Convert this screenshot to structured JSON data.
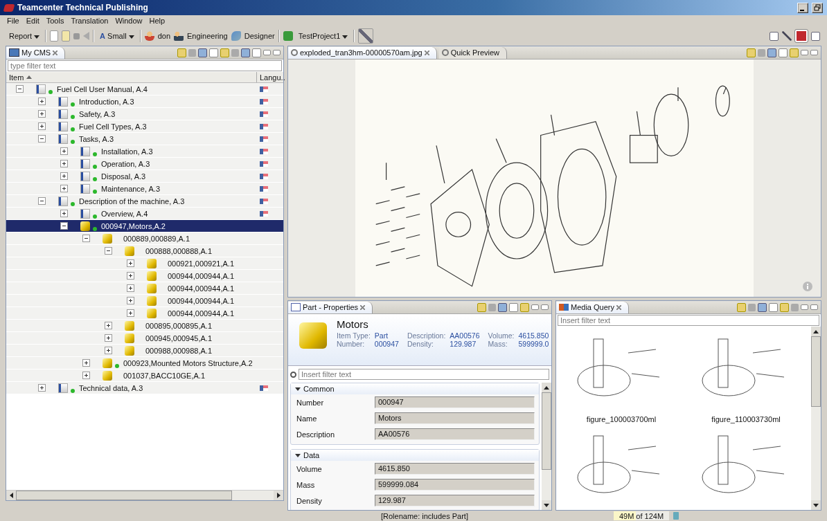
{
  "window": {
    "title": "Teamcenter Technical Publishing"
  },
  "menu": [
    "File",
    "Edit",
    "Tools",
    "Translation",
    "Window",
    "Help"
  ],
  "toolbar": {
    "report": "Report",
    "font_icon": "A",
    "font_size": "Small",
    "user": "don",
    "group": "Engineering",
    "role": "Designer",
    "project": "TestProject1"
  },
  "cms_panel": {
    "title": "My CMS",
    "filter_placeholder": "type filter text",
    "columns": [
      "Item",
      "Langu.."
    ],
    "items": [
      {
        "label": "Fuel Cell User Manual, A.4",
        "kind": "document",
        "status_dot": true,
        "expanded": true,
        "selected": false,
        "children": [
          {
            "label": "Introduction, A.3",
            "kind": "document",
            "status_dot": true,
            "expanded": false,
            "selected": false
          },
          {
            "label": "Safety, A.3",
            "kind": "document",
            "status_dot": true,
            "expanded": false,
            "selected": false
          },
          {
            "label": "Fuel Cell Types, A.3",
            "kind": "document",
            "status_dot": true,
            "expanded": false,
            "selected": false
          },
          {
            "label": "Tasks, A.3",
            "kind": "document",
            "status_dot": true,
            "expanded": true,
            "selected": false,
            "children": [
              {
                "label": "Installation, A.3",
                "kind": "document",
                "status_dot": true,
                "expanded": false,
                "selected": false
              },
              {
                "label": "Operation, A.3",
                "kind": "document",
                "status_dot": true,
                "expanded": false,
                "selected": false
              },
              {
                "label": "Disposal, A.3",
                "kind": "document",
                "status_dot": true,
                "expanded": false,
                "selected": false
              },
              {
                "label": "Maintenance, A.3",
                "kind": "document",
                "status_dot": true,
                "expanded": false,
                "selected": false
              }
            ]
          },
          {
            "label": "Description of the machine, A.3",
            "kind": "document",
            "status_dot": true,
            "expanded": true,
            "selected": false,
            "children": [
              {
                "label": "Overview, A.4",
                "kind": "document",
                "status_dot": true,
                "expanded": false,
                "selected": false
              },
              {
                "label": "000947,Motors,A.2",
                "kind": "part",
                "status_dot": true,
                "expanded": true,
                "selected": true,
                "children": [
                  {
                    "label": "000889,000889,A.1",
                    "kind": "part",
                    "status_dot": false,
                    "expanded": true,
                    "selected": false,
                    "children": [
                      {
                        "label": "000888,000888,A.1",
                        "kind": "part",
                        "status_dot": false,
                        "expanded": true,
                        "selected": false,
                        "children": [
                          {
                            "label": "000921,000921,A.1",
                            "kind": "part",
                            "status_dot": false,
                            "expanded": false,
                            "selected": false
                          },
                          {
                            "label": "000944,000944,A.1",
                            "kind": "part",
                            "status_dot": false,
                            "expanded": false,
                            "selected": false
                          },
                          {
                            "label": "000944,000944,A.1",
                            "kind": "part",
                            "status_dot": false,
                            "expanded": false,
                            "selected": false
                          },
                          {
                            "label": "000944,000944,A.1",
                            "kind": "part",
                            "status_dot": false,
                            "expanded": false,
                            "selected": false
                          },
                          {
                            "label": "000944,000944,A.1",
                            "kind": "part",
                            "status_dot": false,
                            "expanded": false,
                            "selected": false
                          }
                        ]
                      },
                      {
                        "label": "000895,000895,A.1",
                        "kind": "part",
                        "status_dot": false,
                        "expanded": false,
                        "selected": false
                      },
                      {
                        "label": "000945,000945,A.1",
                        "kind": "part",
                        "status_dot": false,
                        "expanded": false,
                        "selected": false
                      },
                      {
                        "label": "000988,000988,A.1",
                        "kind": "part",
                        "status_dot": false,
                        "expanded": false,
                        "selected": false
                      }
                    ]
                  },
                  {
                    "label": "000923,Mounted Motors Structure,A.2",
                    "kind": "part",
                    "status_dot": true,
                    "expanded": false,
                    "selected": false
                  },
                  {
                    "label": "001037,BACC10GE,A.1",
                    "kind": "part",
                    "status_dot": false,
                    "expanded": false,
                    "selected": false
                  }
                ]
              }
            ]
          },
          {
            "label": "Technical data, A.3",
            "kind": "document",
            "status_dot": true,
            "expanded": false,
            "selected": false
          }
        ]
      }
    ]
  },
  "editor": {
    "tabs": [
      {
        "label": "exploded_tran3hm-00000570am.jpg",
        "selected": true
      },
      {
        "label": "Quick Preview",
        "selected": false
      }
    ]
  },
  "properties": {
    "title": "Part - Properties",
    "name": "Motors",
    "summary": [
      {
        "label": "Item Type:",
        "value": "Part"
      },
      {
        "label": "Description:",
        "value": "AA00576"
      },
      {
        "label": "Volume:",
        "value": "4615.850"
      },
      {
        "label": "Number:",
        "value": "000947"
      },
      {
        "label": "Density:",
        "value": "129.987"
      },
      {
        "label": "Mass:",
        "value": "599999.0"
      }
    ],
    "filter_placeholder": "Insert filter text",
    "sections": [
      {
        "title": "Common",
        "expanded": true,
        "fields": [
          {
            "label": "Number",
            "value": "000947"
          },
          {
            "label": "Name",
            "value": "Motors"
          },
          {
            "label": "Description",
            "value": "AA00576"
          }
        ]
      },
      {
        "title": "Data",
        "expanded": true,
        "fields": [
          {
            "label": "Volume",
            "value": "4615.850"
          },
          {
            "label": "Mass",
            "value": "599999.084"
          },
          {
            "label": "Density",
            "value": "129.987"
          }
        ]
      }
    ]
  },
  "media_query": {
    "title": "Media Query",
    "filter_placeholder": "Insert filter text",
    "items": [
      {
        "kind": "captioned",
        "caption": "figure_100003700ml"
      },
      {
        "kind": "captioned",
        "caption": "figure_110003730ml"
      },
      {
        "kind": "cut"
      },
      {
        "kind": "cut"
      }
    ]
  },
  "status_bar": {
    "message": "[Rolename: includes Part]",
    "memory": {
      "text": "49M of 124M",
      "level": 0.4
    }
  }
}
